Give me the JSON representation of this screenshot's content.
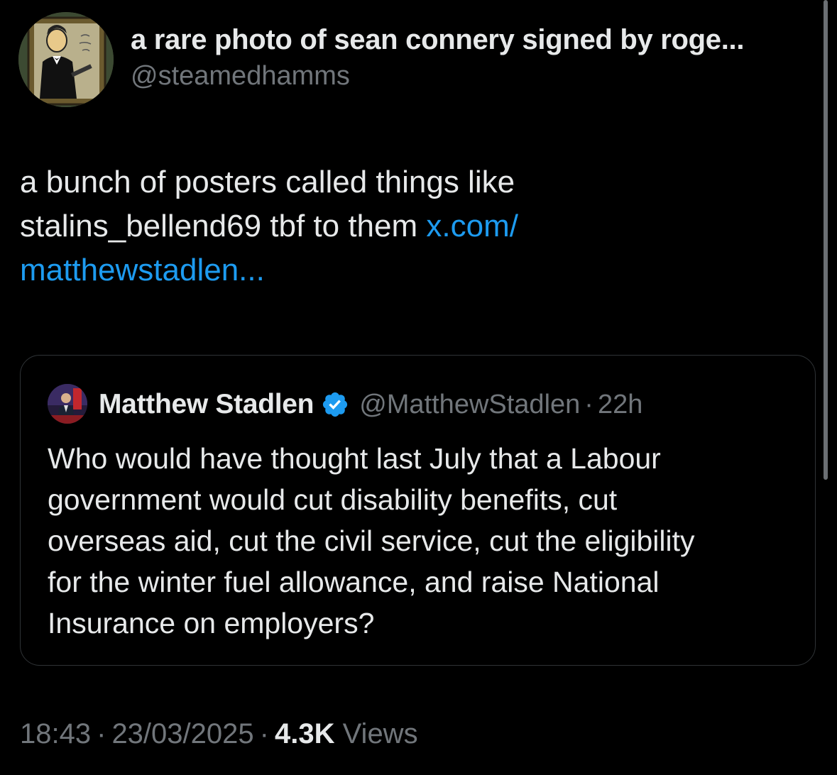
{
  "author": {
    "display_name": "a rare photo of sean connery signed by roge...",
    "handle": "@steamedhamms",
    "avatar_icon": "framed-cartoon-portrait-avatar"
  },
  "tweet": {
    "lines": [
      "a bunch of posters called things like",
      "stalins_bellend69 tbf to them ",
      "matthewstadlen..."
    ],
    "link_inline": "x.com/",
    "link_color": "#1d9bf0"
  },
  "quote": {
    "name": "Matthew Stadlen",
    "verified_icon": "verified-badge-icon",
    "handle": "@MatthewStadlen",
    "separator": "·",
    "time": "22h",
    "lines": [
      "Who would have thought last July that a Labour",
      "government would cut disability benefits, cut",
      "overseas aid, cut the civil service, cut the eligibility",
      "for the winter fuel allowance, and raise National",
      "Insurance on employers?"
    ]
  },
  "meta": {
    "time": "18:43",
    "sep1": "·",
    "date": "23/03/2025",
    "sep2": "·",
    "views_count": "4.3K",
    "views_label": "Views"
  },
  "colors": {
    "background": "#000000",
    "text_primary": "#e7e9ea",
    "text_secondary": "#71767b",
    "accent": "#1d9bf0",
    "border": "#2f3336"
  }
}
